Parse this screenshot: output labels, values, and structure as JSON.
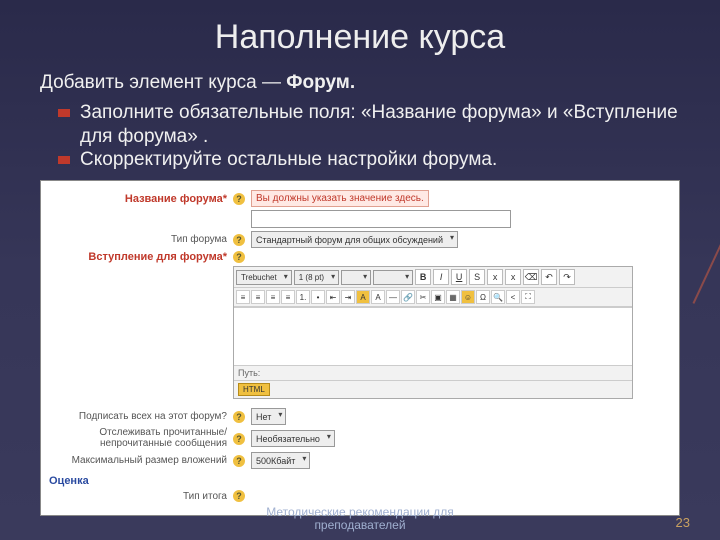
{
  "title": "Наполнение курса",
  "intro_prefix": "Добавить элемент курса  — ",
  "intro_bold": "Форум.",
  "bullets": [
    "Заполните обязательные поля: «Название форума» и «Вступление для форума» .",
    "Скорректируйте остальные настройки форума."
  ],
  "form": {
    "name_label": "Название форума*",
    "name_error": "Вы должны указать значение здесь.",
    "type_label": "Тип форума",
    "type_value": "Стандартный форум для общих обсуждений",
    "intro_label": "Вступление для форума*",
    "editor_font": "Trebuchet",
    "editor_size": "1 (8 pt)",
    "editor_path": "Путь:",
    "editor_html_btn": "HTML",
    "subscribe_label": "Подписать всех на этот форум?",
    "subscribe_value": "Нет",
    "track_label": "Отслеживать прочитанные/непрочитанные сообщения",
    "track_value": "Необязательно",
    "maxsize_label": "Максимальный размер вложений",
    "maxsize_value": "500Кбайт",
    "grade_section": "Оценка",
    "grade_type_label": "Тип итога"
  },
  "footer1": "Методические рекомендации для",
  "footer2": "преподавателей",
  "page": "23"
}
